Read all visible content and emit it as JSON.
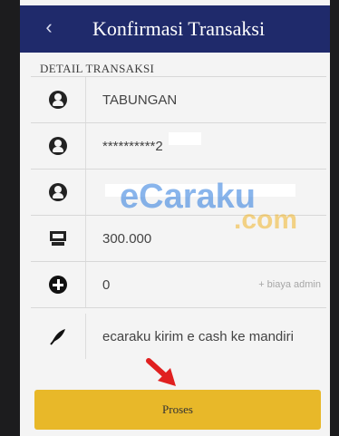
{
  "header": {
    "back_label": "‹",
    "title": "Konfirmasi Transaksi"
  },
  "section_label": "DETAIL TRANSAKSI",
  "rows": [
    {
      "icon": "user-icon",
      "text": "TABUNGAN"
    },
    {
      "icon": "user-icon",
      "text": "**********2"
    },
    {
      "icon": "user-icon",
      "text": ""
    },
    {
      "icon": "money-icon",
      "text": "300.000"
    },
    {
      "icon": "plus-icon",
      "text": "0",
      "sub": "+ biaya admin"
    },
    {
      "icon": "feather-icon",
      "text": "ecaraku kirim e cash ke mandiri"
    }
  ],
  "watermark": {
    "brand": "eCaraku",
    "suffix": ".com"
  },
  "button": {
    "label": "Proses"
  },
  "colors": {
    "header": "#1f2a6b",
    "button": "#e8b829",
    "arrow": "#e02020"
  }
}
